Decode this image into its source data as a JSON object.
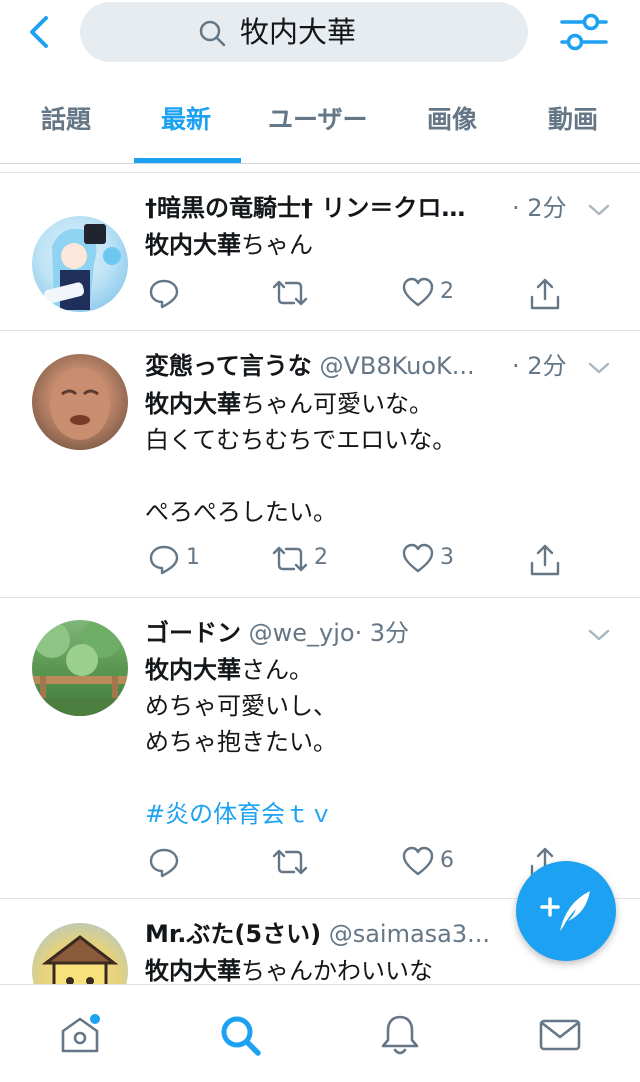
{
  "search": {
    "query": "牧内大華"
  },
  "tabs": [
    {
      "label": "話題"
    },
    {
      "label": "最新"
    },
    {
      "label": "ユーザー"
    },
    {
      "label": "画像"
    },
    {
      "label": "動画"
    }
  ],
  "tweets": [
    {
      "name": "†暗黒の竜騎士† リン＝クロ…",
      "handle": "",
      "time": "· 2分",
      "lines": [
        {
          "bold": "牧内大華",
          "rest": "ちゃん"
        }
      ],
      "reply_count": "",
      "retweet_count": "",
      "like_count": "2"
    },
    {
      "name": "変態って言うな",
      "handle": "@VB8KuoK...",
      "time": "· 2分",
      "lines": [
        {
          "bold": "牧内大華",
          "rest": "ちゃん可愛いな。"
        },
        {
          "bold": "",
          "rest": "白くてむちむちでエロいな。"
        },
        {
          "bold": "",
          "rest": ""
        },
        {
          "bold": "",
          "rest": "ぺろぺろしたい。"
        }
      ],
      "reply_count": "1",
      "retweet_count": "2",
      "like_count": "3"
    },
    {
      "name": "ゴードン",
      "handle": "@we_yjo",
      "time": "· 3分",
      "lines": [
        {
          "bold": "牧内大華",
          "rest": "さん。"
        },
        {
          "bold": "",
          "rest": "めちゃ可愛いし、"
        },
        {
          "bold": "",
          "rest": "めちゃ抱きたい。"
        },
        {
          "bold": "",
          "rest": ""
        }
      ],
      "hashtag": "#炎の体育会ｔｖ",
      "reply_count": "",
      "retweet_count": "",
      "like_count": "6"
    },
    {
      "name": "Mr.ぶた(5さい)",
      "handle": "@saimasa3...",
      "time": "",
      "lines": [
        {
          "bold": "牧内大華",
          "rest": "ちゃんかわいいな"
        }
      ]
    }
  ],
  "colors": {
    "accent": "#1da1f2",
    "muted": "#657786",
    "text": "#14171a"
  }
}
